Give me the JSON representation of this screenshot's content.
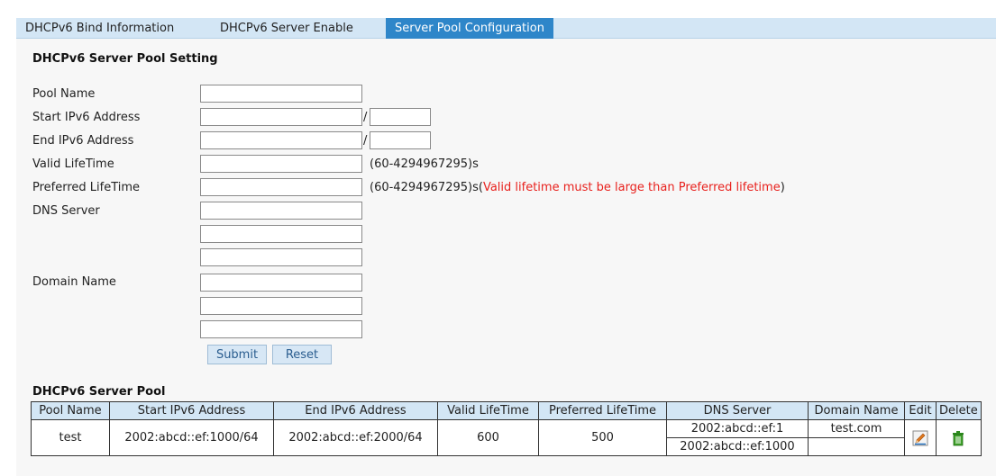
{
  "tabs": [
    {
      "label": "DHCPv6 Bind Information",
      "active": false
    },
    {
      "label": "DHCPv6 Server Enable",
      "active": false
    },
    {
      "label": "Server Pool Configuration",
      "active": true
    }
  ],
  "form": {
    "title": "DHCPv6 Server Pool Setting",
    "pool_name_label": "Pool Name",
    "start_label": "Start IPv6 Address",
    "end_label": "End IPv6 Address",
    "valid_label": "Valid LifeTime",
    "preferred_label": "Preferred LifeTime",
    "dns_label": "DNS Server",
    "domain_label": "Domain Name",
    "slash": "/",
    "valid_hint": "(60-4294967295)s",
    "preferred_hint": "(60-4294967295)s(",
    "preferred_warning": "Valid lifetime must be large than Preferred lifetime",
    "preferred_hint_end": ")",
    "submit_label": "Submit",
    "reset_label": "Reset",
    "values": {
      "pool_name": "",
      "start_addr": "",
      "start_prefix": "",
      "end_addr": "",
      "end_prefix": "",
      "valid": "",
      "preferred": "",
      "dns1": "",
      "dns2": "",
      "dns3": "",
      "domain1": "",
      "domain2": "",
      "domain3": ""
    }
  },
  "pool": {
    "title": "DHCPv6 Server Pool",
    "columns": [
      "Pool Name",
      "Start IPv6 Address",
      "End IPv6 Address",
      "Valid LifeTime",
      "Preferred LifeTime",
      "DNS Server",
      "Domain Name",
      "Edit",
      "Delete"
    ],
    "rows": [
      {
        "pool_name": "test",
        "start": "2002:abcd::ef:1000/64",
        "end": "2002:abcd::ef:2000/64",
        "valid": "600",
        "preferred": "500",
        "dns": [
          "2002:abcd::ef:1",
          "2002:abcd::ef:1000"
        ],
        "domain": [
          "test.com",
          ""
        ],
        "edit_icon": "edit-pencil-icon",
        "delete_icon": "trash-icon"
      }
    ]
  },
  "colors": {
    "tab_active": "#2e86c9",
    "tab_strip": "#d3e6f5",
    "warning": "#e8211d",
    "panel": "#f7f7f7"
  }
}
